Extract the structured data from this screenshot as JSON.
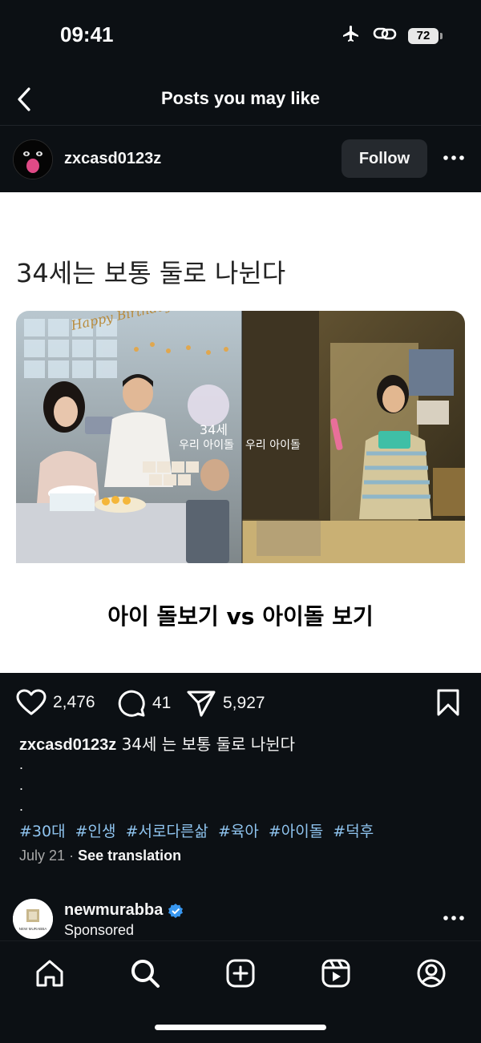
{
  "status_bar": {
    "time": "09:41",
    "battery": "72"
  },
  "nav": {
    "title": "Posts you may like"
  },
  "post": {
    "username": "zxcasd0123z",
    "follow_label": "Follow",
    "media_title": "34세는 보통 둘로 나뉜다",
    "media_overlay_left": "34세",
    "media_overlay_left_sub": "우리 아이돌",
    "media_overlay_right": "우리 아이돌",
    "media_banner": "Happy Birthday",
    "media_caption": "아이 돌보기 vs 아이돌 보기",
    "likes": "2,476",
    "comments": "41",
    "shares": "5,927",
    "caption_user": "zxcasd0123z",
    "caption_text": "34세 는 보통 둘로 나뉜다",
    "caption_dots": [
      ".",
      ".",
      "."
    ],
    "hashtags": [
      "#30대",
      "#인생",
      "#서로다른삶",
      "#육아",
      "#아이돌",
      "#덕후"
    ],
    "date": "July 21",
    "see_translation": "See translation"
  },
  "sponsored": {
    "name": "newmurabba",
    "label": "Sponsored",
    "avatar_text": "NEW MURABBA"
  },
  "colors": {
    "background": "#0c1014",
    "hashtag": "#8fc4ef",
    "verified": "#3897f0"
  }
}
